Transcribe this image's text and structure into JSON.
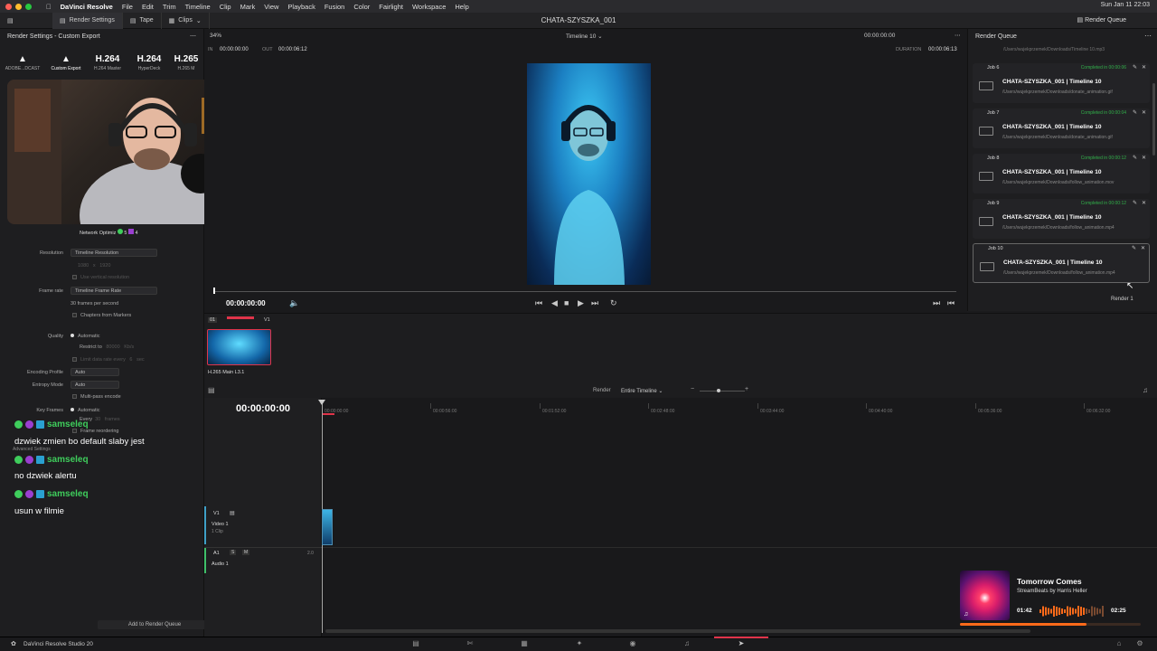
{
  "menubar": {
    "app": "DaVinci Resolve",
    "items": [
      "File",
      "Edit",
      "Trim",
      "Timeline",
      "Clip",
      "Mark",
      "View",
      "Playback",
      "Fusion",
      "Color",
      "Fairlight",
      "Workspace",
      "Help"
    ],
    "clock": "Sun Jan 11 22:03"
  },
  "toolbar": {
    "render_settings": "Render Settings",
    "tape": "Tape",
    "clips": "Clips",
    "project_title": "CHATA-SZYSZKA_001",
    "render_queue": "Render Queue"
  },
  "render_settings": {
    "header": "Render Settings - Custom Export",
    "presets": [
      {
        "big": "",
        "label": "ADOBE...DCAST"
      },
      {
        "big": "",
        "label": "Custom Export"
      },
      {
        "big": "H.264",
        "label": "H.264 Master"
      },
      {
        "big": "H.264",
        "label": "HyperDeck"
      },
      {
        "big": "H.265",
        "label": "H.265 M"
      }
    ],
    "network_opt": "Network Optimiz",
    "badge_a": "5",
    "badge_b": "4",
    "resolution_label": "Resolution",
    "resolution_value": "Timeline Resolution",
    "res_w": "1080",
    "res_x": "x",
    "res_h": "1920",
    "use_vertical": "Use vertical resolution",
    "frame_rate_label": "Frame rate",
    "frame_rate_value": "Timeline Frame Rate",
    "fps_text": "30 frames per second",
    "chapters": "Chapters from Markers",
    "quality_label": "Quality",
    "quality_auto": "Automatic",
    "restrict_to": "Restrict to",
    "restrict_val": "80000",
    "restrict_unit": "Kb/s",
    "limit_rate": "Limit data rate every",
    "limit_val": "6",
    "limit_unit": "sec",
    "encoding_profile_label": "Encoding Profile",
    "encoding_profile_value": "Auto",
    "entropy_label": "Entropy Mode",
    "entropy_value": "Auto",
    "multipass": "Multi-pass encode",
    "keyframes_label": "Key Frames",
    "keyframes_auto": "Automatic",
    "every": "Every",
    "every_val": "30",
    "frames": "frames",
    "frame_reorder": "Frame reordering",
    "advanced": "Advanced Settings",
    "add_to_queue": "Add to Render Queue"
  },
  "chat": [
    {
      "user": "samseleq",
      "msg": "dzwiek zmien bo default slaby jest"
    },
    {
      "user": "samseleq",
      "msg": "no dzwiek alertu"
    },
    {
      "user": "samseleq",
      "msg": "usun w filmie"
    }
  ],
  "viewer": {
    "zoom": "34%",
    "timeline_name": "Timeline 10",
    "tc_top": "00:00:00:00",
    "in_label": "IN",
    "in_tc": "00:00:00:00",
    "out_label": "OUT",
    "out_tc": "00:00:06:12",
    "duration_label": "DURATION",
    "duration_tc": "00:00:06:13",
    "current_tc": "00:00:00:00"
  },
  "clips": {
    "index": "01",
    "track": "V1",
    "clip_label": "H.265 Main L3.1"
  },
  "timeline": {
    "render_label": "Render",
    "render_value": "Entire Timeline",
    "big_tc": "00:00:00:00",
    "ticks": [
      "00:00:00:00",
      "00:00:56:00",
      "00:01:52:00",
      "00:02:48:00",
      "00:03:44:00",
      "00:04:40:00",
      "00:05:36:00",
      "00:06:32:00"
    ],
    "v1": "V1",
    "video1": "Video 1",
    "video1_sub": "1 Clip",
    "a1": "A1",
    "audio1": "Audio 1",
    "a1_s": "S",
    "a1_m": "M",
    "a1_ch": "2.0"
  },
  "render_queue": {
    "title": "Render Queue",
    "top_path": "/Users/wujekprzemek/Downloads/Timeline 10.mp3",
    "jobs": [
      {
        "id": "Job 6",
        "status": "Completed in 00:00:06",
        "title": "CHATA-SZYSZKA_001 | Timeline 10",
        "path": "/Users/wujekprzemek/Downloads/donate_animation.gif"
      },
      {
        "id": "Job 7",
        "status": "Completed in 00:00:04",
        "title": "CHATA-SZYSZKA_001 | Timeline 10",
        "path": "/Users/wujekprzemek/Downloads/donate_animation.gif"
      },
      {
        "id": "Job 8",
        "status": "Completed in 00:00:12",
        "title": "CHATA-SZYSZKA_001 | Timeline 10",
        "path": "/Users/wujekprzemek/Downloads/follow_animation.mov"
      },
      {
        "id": "Job 9",
        "status": "Completed in 00:00:12",
        "title": "CHATA-SZYSZKA_001 | Timeline 10",
        "path": "/Users/wujekprzemek/Downloads/follow_animation.mp4"
      },
      {
        "id": "Job 10",
        "status": "",
        "title": "CHATA-SZYSZKA_001 | Timeline 10",
        "path": "/Users/wujekprzemek/Downloads/follow_animation.mp4"
      }
    ],
    "render_btn": "Render 1"
  },
  "music": {
    "title": "Tomorrow Comes",
    "artist": "StreamBeats by Harris Heller",
    "elapsed": "01:42",
    "total": "02:25",
    "progress": 0.7
  },
  "bottom": {
    "app_name": "DaVinci Resolve Studio 20"
  },
  "colors": {
    "accent_red": "#e0344a",
    "completed_green": "#32b04a",
    "chat_green": "#3fcd5c",
    "music_orange": "#ff6a1a"
  }
}
